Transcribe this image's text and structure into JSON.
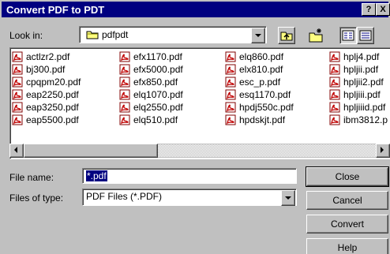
{
  "title": "Convert PDF to PDT",
  "titlebar": {
    "help": "?",
    "close": "X"
  },
  "look_in": {
    "label": "Look in:",
    "value": "pdfpdt"
  },
  "files": [
    [
      "actlzr2.pdf",
      "bj300.pdf",
      "cpqpm20.pdf",
      "eap2250.pdf",
      "eap3250.pdf",
      "eap5500.pdf"
    ],
    [
      "efx1170.pdf",
      "efx5000.pdf",
      "efx850.pdf",
      "elq1070.pdf",
      "elq2550.pdf",
      "elq510.pdf"
    ],
    [
      "elq860.pdf",
      "elx810.pdf",
      "esc_p.pdf",
      "esq1170.pdf",
      "hpdj550c.pdf",
      "hpdskjt.pdf"
    ],
    [
      "hplj4.pdf",
      "hpljii.pdf",
      "hpljii2.pdf",
      "hpljiii.pdf",
      "hpljiiid.pdf",
      "ibm3812.p"
    ]
  ],
  "file_name": {
    "label": "File name:",
    "value": "*.pdf"
  },
  "file_type": {
    "label": "Files of type:",
    "value": "PDF Files (*.PDF)"
  },
  "buttons": {
    "close": "Close",
    "cancel": "Cancel",
    "convert": "Convert",
    "help": "Help"
  }
}
